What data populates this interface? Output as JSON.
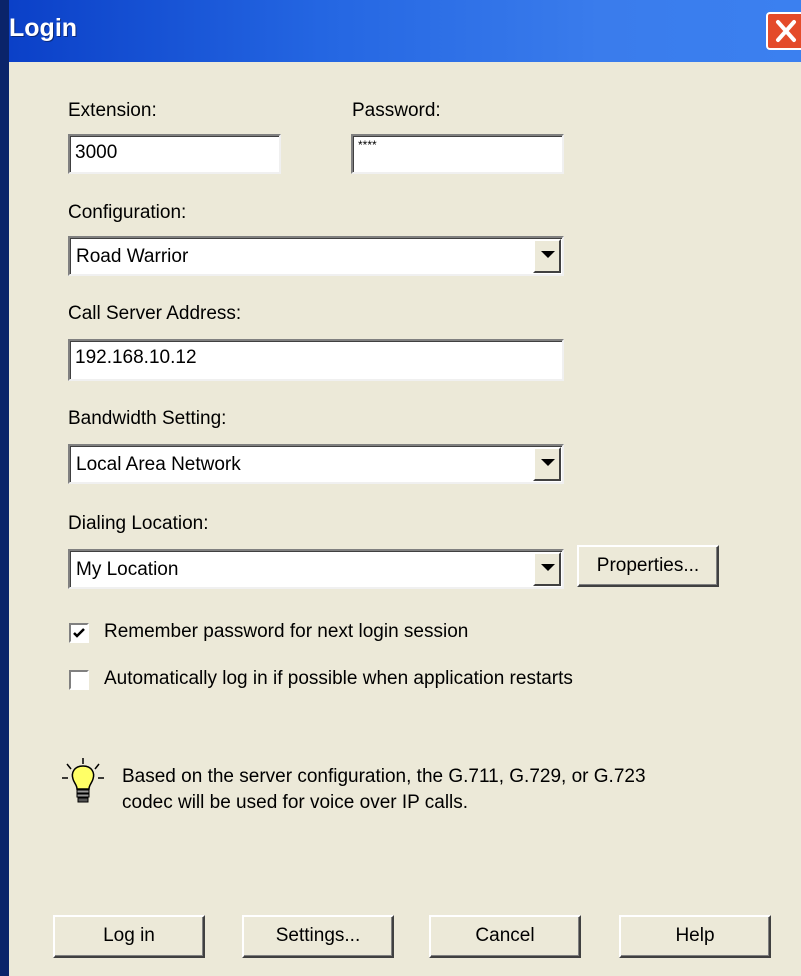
{
  "window": {
    "title": "Login"
  },
  "extension": {
    "label": "Extension:",
    "value": "3000"
  },
  "password": {
    "label": "Password:",
    "value": "****"
  },
  "configuration": {
    "label": "Configuration:",
    "value": "Road Warrior"
  },
  "call_server": {
    "label": "Call Server Address:",
    "value": "192.168.10.12"
  },
  "bandwidth": {
    "label": "Bandwidth Setting:",
    "value": "Local Area Network"
  },
  "dialing": {
    "label": "Dialing Location:",
    "value": "My Location",
    "properties_label": "Properties..."
  },
  "options": [
    {
      "label": "Remember password for next login session",
      "checked": true
    },
    {
      "label": "Automatically log in if possible when application restarts",
      "checked": false
    }
  ],
  "info": {
    "line1": "Based on the server configuration, the G.711, G.729, or G.723",
    "line2": "codec will be used for voice over IP calls.",
    "icon": "lightbulb-icon"
  },
  "buttons": {
    "login": "Log in",
    "settings": "Settings...",
    "cancel": "Cancel",
    "help": "Help"
  }
}
